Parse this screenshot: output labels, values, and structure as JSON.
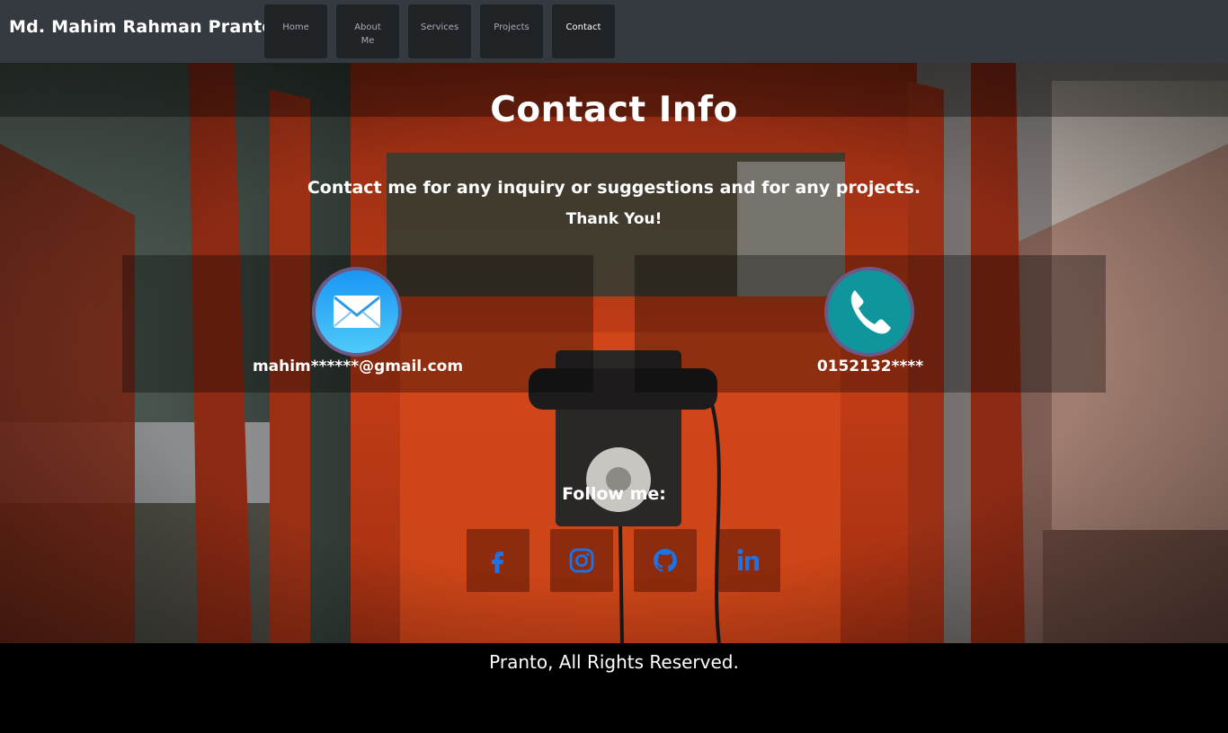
{
  "navbar": {
    "brand": "Md. Mahim Rahman Pranto",
    "items": [
      {
        "label": "Home"
      },
      {
        "label": "About Me"
      },
      {
        "label": "Services"
      },
      {
        "label": "Projects"
      },
      {
        "label": "Contact",
        "active": true
      }
    ]
  },
  "contact": {
    "title": "Contact Info",
    "subtitle": "Contact me for any inquiry or suggestions and for any projects.",
    "thanks": "Thank You!",
    "email": {
      "icon": "envelope-icon",
      "value": "mahim******@gmail.com"
    },
    "phone": {
      "icon": "phone-icon",
      "value": "0152132****"
    }
  },
  "follow": {
    "label": "Follow me:",
    "links": [
      {
        "icon": "facebook-icon"
      },
      {
        "icon": "instagram-icon"
      },
      {
        "icon": "github-icon"
      },
      {
        "icon": "linkedin-icon"
      }
    ]
  },
  "footer": {
    "text": "Pranto, All Rights Reserved."
  },
  "colors": {
    "navbar": "#343a40",
    "nav_button": "#202326",
    "social_icon": "#1a73e8",
    "footer": "#000000"
  }
}
